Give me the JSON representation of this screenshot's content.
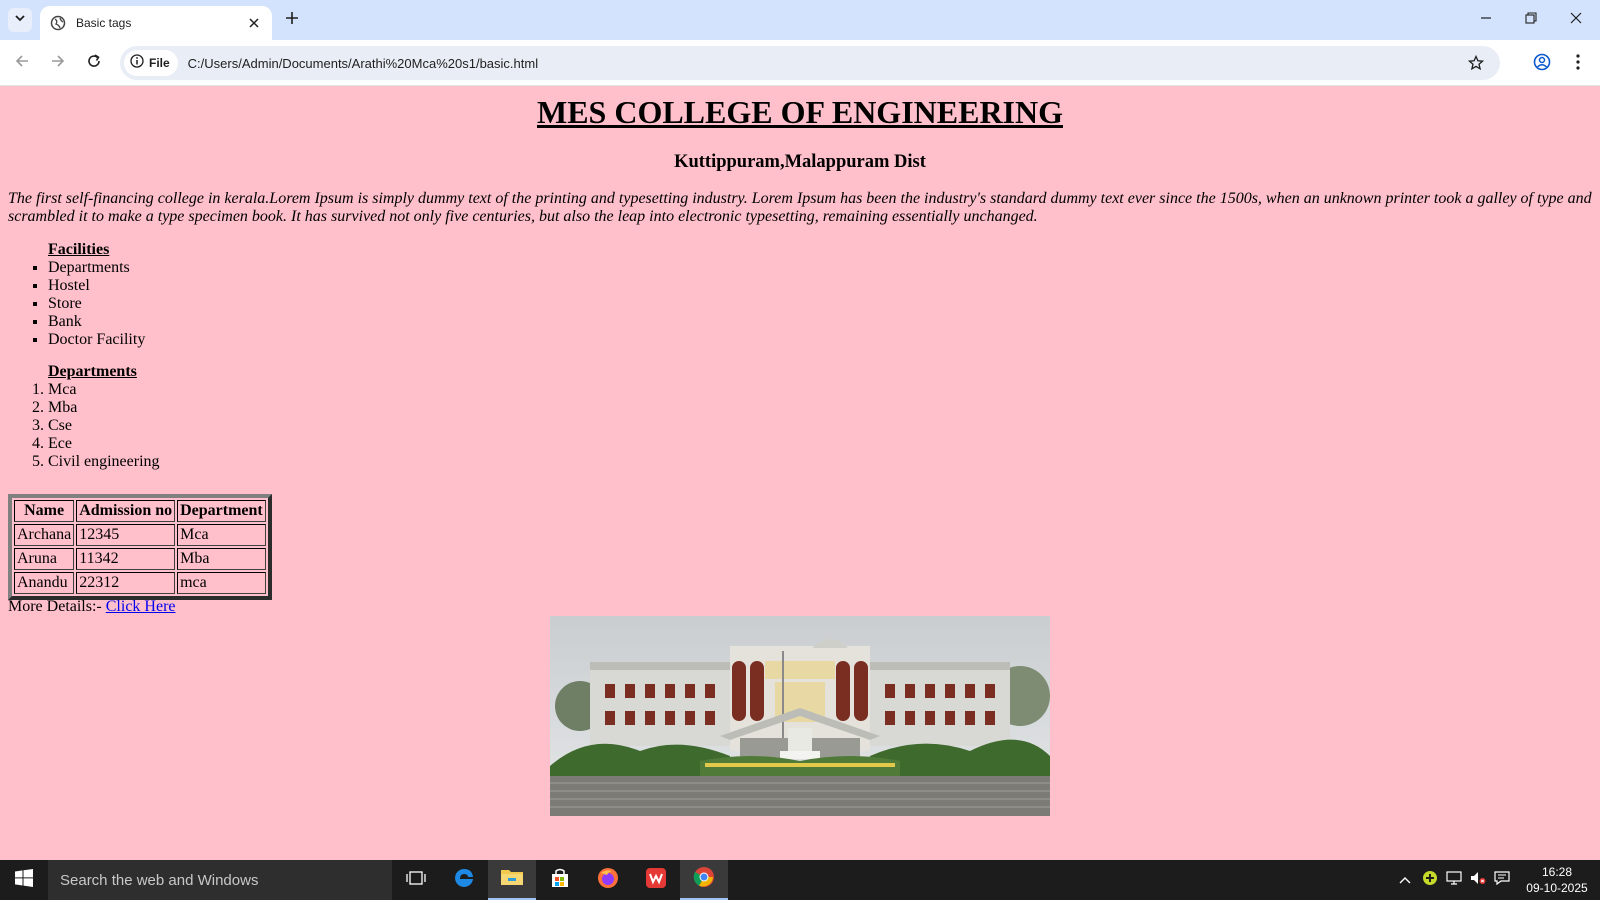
{
  "browser": {
    "tab_title": "Basic tags",
    "address_chip": "File",
    "url": "C:/Users/Admin/Documents/Arathi%20Mca%20s1/basic.html"
  },
  "page": {
    "title": "MES COLLEGE OF ENGINEERING",
    "subtitle": "Kuttippuram,Malappuram Dist",
    "intro": "The first self-financing college in kerala.Lorem Ipsum is simply dummy text of the printing and typesetting industry. Lorem Ipsum has been the industry's standard dummy text ever since the 1500s, when an unknown printer took a galley of type and scrambled it to make a type specimen book. It has survived not only five centuries, but also the leap into electronic typesetting, remaining essentially unchanged.",
    "facilities": {
      "heading": "Facilities",
      "items": [
        "Departments",
        "Hostel",
        "Store",
        "Bank",
        "Doctor Facility"
      ]
    },
    "departments": {
      "heading": "Departments",
      "items": [
        "Mca",
        "Mba",
        "Cse",
        "Ece",
        "Civil engineering"
      ]
    },
    "table": {
      "headers": [
        "Name",
        "Admission no",
        "Department"
      ],
      "rows": [
        [
          "Archana",
          "12345",
          "Mca"
        ],
        [
          "Aruna",
          "11342",
          "Mba"
        ],
        [
          "Anandu",
          "22312",
          "mca"
        ]
      ]
    },
    "more_details_label": "More Details:-",
    "more_details_link": "Click Here",
    "background_color": "#ffc0cb"
  },
  "taskbar": {
    "search_placeholder": "Search the web and Windows",
    "time": "16:28",
    "date": "09-10-2025"
  }
}
